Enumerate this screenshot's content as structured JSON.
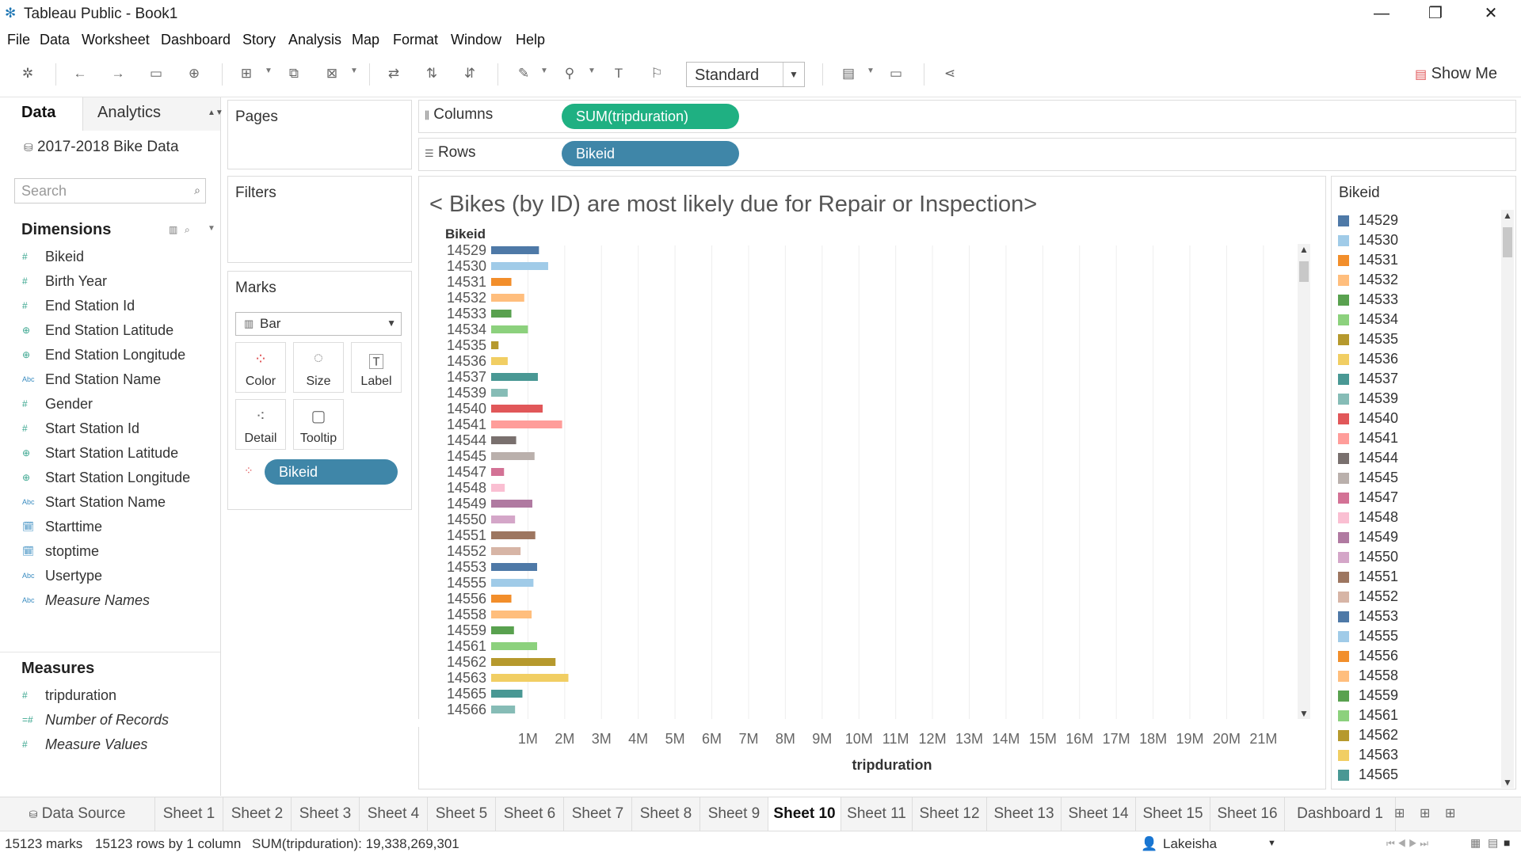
{
  "window": {
    "title": "Tableau Public - Book1"
  },
  "menu": [
    "File",
    "Data",
    "Worksheet",
    "Dashboard",
    "Story",
    "Analysis",
    "Map",
    "Format",
    "Window",
    "Help"
  ],
  "toolbar": {
    "fit": "Standard",
    "show_me": "Show Me"
  },
  "data_pane": {
    "tab_data": "Data",
    "tab_analytics": "Analytics",
    "datasource": "2017-2018 Bike Data",
    "search_placeholder": "Search",
    "dimensions_header": "Dimensions",
    "dimensions": [
      {
        "name": "Bikeid",
        "type": "#"
      },
      {
        "name": "Birth Year",
        "type": "#"
      },
      {
        "name": "End Station Id",
        "type": "#"
      },
      {
        "name": "End Station Latitude",
        "type": "globe"
      },
      {
        "name": "End Station Longitude",
        "type": "globe"
      },
      {
        "name": "End Station Name",
        "type": "Abc"
      },
      {
        "name": "Gender",
        "type": "#"
      },
      {
        "name": "Start Station Id",
        "type": "#"
      },
      {
        "name": "Start Station Latitude",
        "type": "globe"
      },
      {
        "name": "Start Station Longitude",
        "type": "globe"
      },
      {
        "name": "Start Station Name",
        "type": "Abc"
      },
      {
        "name": "Starttime",
        "type": "date"
      },
      {
        "name": "stoptime",
        "type": "date"
      },
      {
        "name": "Usertype",
        "type": "Abc"
      },
      {
        "name": "Measure Names",
        "type": "Abc",
        "italic": true
      }
    ],
    "measures_header": "Measures",
    "measures": [
      {
        "name": "tripduration",
        "type": "#"
      },
      {
        "name": "Number of Records",
        "type": "=#",
        "italic": true
      },
      {
        "name": "Measure Values",
        "type": "#",
        "italic": true
      }
    ]
  },
  "cards": {
    "pages": "Pages",
    "filters": "Filters",
    "marks": "Marks",
    "mark_type": "Bar",
    "buttons": [
      "Color",
      "Size",
      "Label",
      "Detail",
      "Tooltip"
    ],
    "marks_pill": "Bikeid"
  },
  "shelves": {
    "columns_label": "Columns",
    "columns_pill": "SUM(tripduration)",
    "rows_label": "Rows",
    "rows_pill": "Bikeid"
  },
  "viz": {
    "title": "< Bikes (by ID) are most likely due for Repair or Inspection>"
  },
  "chart_data": {
    "type": "bar",
    "orientation": "horizontal",
    "title": "< Bikes (by ID) are most likely due for Repair or Inspection>",
    "ylabel": "Bikeid",
    "xlabel": "tripduration",
    "x_ticks": [
      "1M",
      "2M",
      "3M",
      "4M",
      "5M",
      "6M",
      "7M",
      "8M",
      "9M",
      "10M",
      "11M",
      "12M",
      "13M",
      "14M",
      "15M",
      "16M",
      "17M",
      "18M",
      "19M",
      "20M",
      "21M"
    ],
    "xlim": [
      0,
      21800000
    ],
    "grid": "vertical",
    "categories": [
      "14529",
      "14530",
      "14531",
      "14532",
      "14533",
      "14534",
      "14535",
      "14536",
      "14537",
      "14539",
      "14540",
      "14541",
      "14544",
      "14545",
      "14547",
      "14548",
      "14549",
      "14550",
      "14551",
      "14552",
      "14553",
      "14555",
      "14556",
      "14558",
      "14559",
      "14561",
      "14562",
      "14563",
      "14565",
      "14566"
    ],
    "values": [
      1300000,
      1550000,
      550000,
      900000,
      550000,
      1000000,
      200000,
      450000,
      1270000,
      450000,
      1400000,
      1930000,
      680000,
      1180000,
      350000,
      370000,
      1120000,
      650000,
      1200000,
      800000,
      1250000,
      1150000,
      550000,
      1100000,
      620000,
      1250000,
      1750000,
      2100000,
      850000,
      650000
    ],
    "colors": [
      "#4e79a7",
      "#a0cbe8",
      "#f28e2b",
      "#ffbe7d",
      "#59a14f",
      "#8cd17d",
      "#b6992d",
      "#f1ce63",
      "#499894",
      "#86bcb6",
      "#e15759",
      "#ff9d9a",
      "#79706e",
      "#bab0ac",
      "#d37295",
      "#fabfd2",
      "#b07aa1",
      "#d4a6c8",
      "#9d7660",
      "#d7b5a6",
      "#4e79a7",
      "#a0cbe8",
      "#f28e2b",
      "#ffbe7d",
      "#59a14f",
      "#8cd17d",
      "#b6992d",
      "#f1ce63",
      "#499894",
      "#86bcb6"
    ]
  },
  "legend": {
    "title": "Bikeid",
    "items": [
      "14529",
      "14530",
      "14531",
      "14532",
      "14533",
      "14534",
      "14535",
      "14536",
      "14537",
      "14539",
      "14540",
      "14541",
      "14544",
      "14545",
      "14547",
      "14548",
      "14549",
      "14550",
      "14551",
      "14552",
      "14553",
      "14555",
      "14556",
      "14558",
      "14559",
      "14561",
      "14562",
      "14563",
      "14565"
    ]
  },
  "sheet_tabs": {
    "data_source": "Data Source",
    "sheets": [
      "Sheet 1",
      "Sheet 2",
      "Sheet 3",
      "Sheet 4",
      "Sheet 5",
      "Sheet 6",
      "Sheet 7",
      "Sheet 8",
      "Sheet 9",
      "Sheet 10",
      "Sheet 11",
      "Sheet 12",
      "Sheet 13",
      "Sheet 14",
      "Sheet 15",
      "Sheet 16",
      "Dashboard 1"
    ],
    "active": "Sheet 10"
  },
  "status": {
    "marks": "15123 marks",
    "rows": "15123 rows by 1 column",
    "sum": "SUM(tripduration): 19,338,269,301",
    "user": "Lakeisha"
  }
}
